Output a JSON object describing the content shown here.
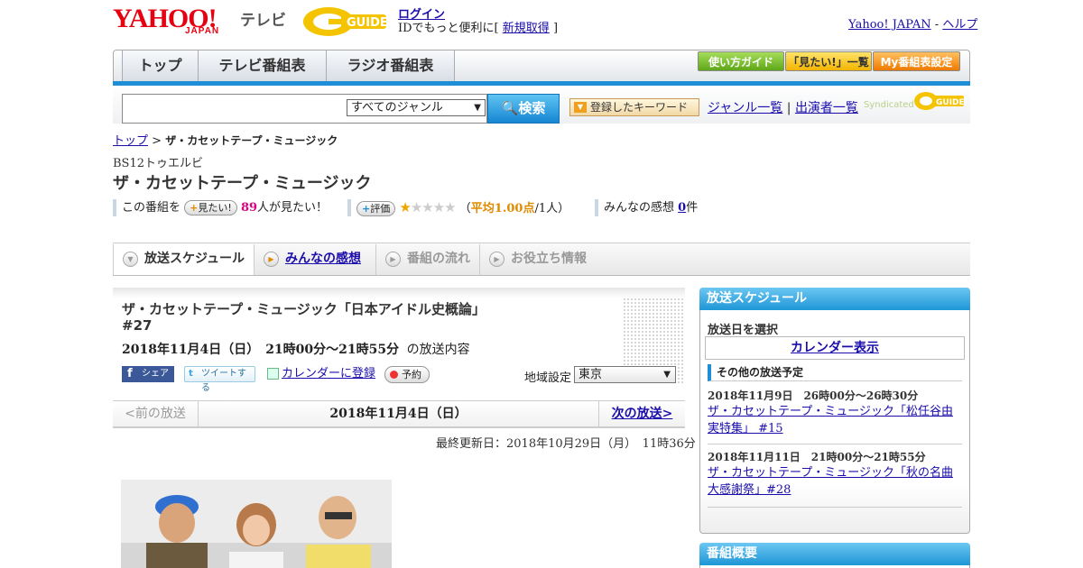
{
  "header": {
    "logo_main": "YAHOO!",
    "logo_sub": "JAPAN",
    "logo_tv": "テレビ",
    "login_label": "ログイン",
    "promo_prefix": "IDでもっと便利に[",
    "promo_link": "新規取得",
    "promo_suffix": "]",
    "yahoo_link": "Yahoo! JAPAN",
    "link_sep": "-",
    "help_link": "ヘルプ"
  },
  "nav": {
    "tabs": [
      "トップ",
      "テレビ番組表",
      "ラジオ番組表"
    ],
    "buttons": [
      "使い方ガイド",
      "「見たい!」一覧",
      "My番組表設定"
    ]
  },
  "search": {
    "genre_selected": "すべてのジャンル",
    "search_label": "検索",
    "keyword_label": "登録したキーワード",
    "genre_list": "ジャンル一覧",
    "link_sep": "|",
    "cast_list": "出演者一覧",
    "syndicated": "Syndicated"
  },
  "breadcrumb": {
    "top": "トップ",
    "sep": ">",
    "current": "ザ・カセットテープ・ミュージック"
  },
  "program": {
    "channel": "BS12トゥエルビ",
    "title": "ザ・カセットテープ・ミュージック",
    "mitai_prefix": "この番組を",
    "mitai_chip": "見たい!",
    "mitai_count": "89",
    "mitai_suffix": "人が見たい！",
    "rating_chip": "評価",
    "rating_open": "（",
    "rating_avg": "平均1.00点",
    "rating_people": "/1人）",
    "rating_value": 1,
    "rating_max": 5,
    "review_prefix": "みんなの感想",
    "review_count": "0",
    "review_suffix": "件"
  },
  "tabs": [
    "放送スケジュール",
    "みんなの感想",
    "番組の流れ",
    "お役立ち情報"
  ],
  "episode": {
    "title": "ザ・カセットテープ・ミュージック「日本アイドル史概論」",
    "number": "#27",
    "date": "2018年11月4日（日）　21時00分～21時55分",
    "date_suffix": "の放送内容",
    "share_fb": "シェア",
    "share_tw": "ツイートする",
    "calendar_add": "カレンダーに登録",
    "reserve": "予約",
    "region_label": "地域設定",
    "region_value": "東京",
    "prev": "<前の放送",
    "current_date": "2018年11月4日（日）",
    "next": "次の放送>",
    "updated": "最終更新日：2018年10月29日（月）　11時36分"
  },
  "sidebar": {
    "schedule_title": "放送スケジュール",
    "select_day": "放送日を選択",
    "calendar_btn": "カレンダー表示",
    "other_title": "その他の放送予定",
    "other": [
      {
        "date": "2018年11月9日　26時00分～26時30分",
        "title": "ザ・カセットテープ・ミュージック「松任谷由実特集」 #15"
      },
      {
        "date": "2018年11月11日　21時00分～21時55分",
        "title": "ザ・カセットテープ・ミュージック「秋の名曲大感謝祭」#28"
      }
    ],
    "summary_title": "番組概要"
  },
  "colors": {
    "accent": "#1e8fd6",
    "brand": "#e60012",
    "link": "#1a0dab"
  }
}
